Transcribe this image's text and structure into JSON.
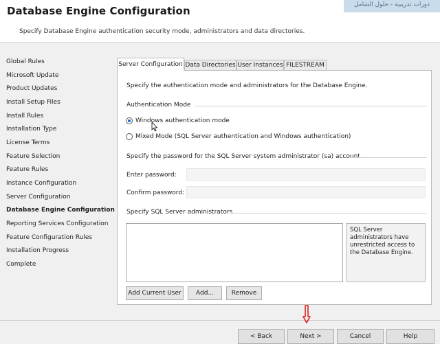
{
  "header": {
    "title": "Database Engine Configuration",
    "subtitle": "Specify Database Engine authentication security mode, administrators and data directories.",
    "watermark": "دورات تدريبية - حلول الشامل"
  },
  "sidebar": {
    "items": [
      {
        "label": "Global Rules",
        "active": false
      },
      {
        "label": "Microsoft Update",
        "active": false
      },
      {
        "label": "Product Updates",
        "active": false
      },
      {
        "label": "Install Setup Files",
        "active": false
      },
      {
        "label": "Install Rules",
        "active": false
      },
      {
        "label": "Installation Type",
        "active": false
      },
      {
        "label": "License Terms",
        "active": false
      },
      {
        "label": "Feature Selection",
        "active": false
      },
      {
        "label": "Feature Rules",
        "active": false
      },
      {
        "label": "Instance Configuration",
        "active": false
      },
      {
        "label": "Server Configuration",
        "active": false
      },
      {
        "label": "Database Engine Configuration",
        "active": true
      },
      {
        "label": "Reporting Services Configuration",
        "active": false
      },
      {
        "label": "Feature Configuration Rules",
        "active": false
      },
      {
        "label": "Installation Progress",
        "active": false
      },
      {
        "label": "Complete",
        "active": false
      }
    ]
  },
  "tabs": [
    {
      "label": "Server Configuration",
      "active": true
    },
    {
      "label": "Data Directories",
      "active": false
    },
    {
      "label": "User Instances",
      "active": false
    },
    {
      "label": "FILESTREAM",
      "active": false
    }
  ],
  "server_config": {
    "intro": "Specify the authentication mode and administrators for the Database Engine.",
    "auth_group_label": "Authentication Mode",
    "windows_auth_label": "Windows authentication mode",
    "windows_auth_selected": true,
    "mixed_mode_label": "Mixed Mode (SQL Server authentication and Windows authentication)",
    "mixed_mode_selected": false,
    "sa_password_instruction": "Specify the password for the SQL Server system administrator (sa) account.",
    "enter_password_label": "Enter password:",
    "confirm_password_label": "Confirm password:",
    "admins_group_label": "Specify SQL Server administrators",
    "admins_info": "SQL Server administrators have unrestricted access to the Database Engine.",
    "add_current_user_label": "Add Current User",
    "add_label": "Add...",
    "remove_label": "Remove"
  },
  "footer": {
    "back_label": "< Back",
    "next_label": "Next >",
    "cancel_label": "Cancel",
    "help_label": "Help"
  },
  "colors": {
    "radio_selected": "#1b66c9",
    "annotation_arrow": "#e02020"
  }
}
